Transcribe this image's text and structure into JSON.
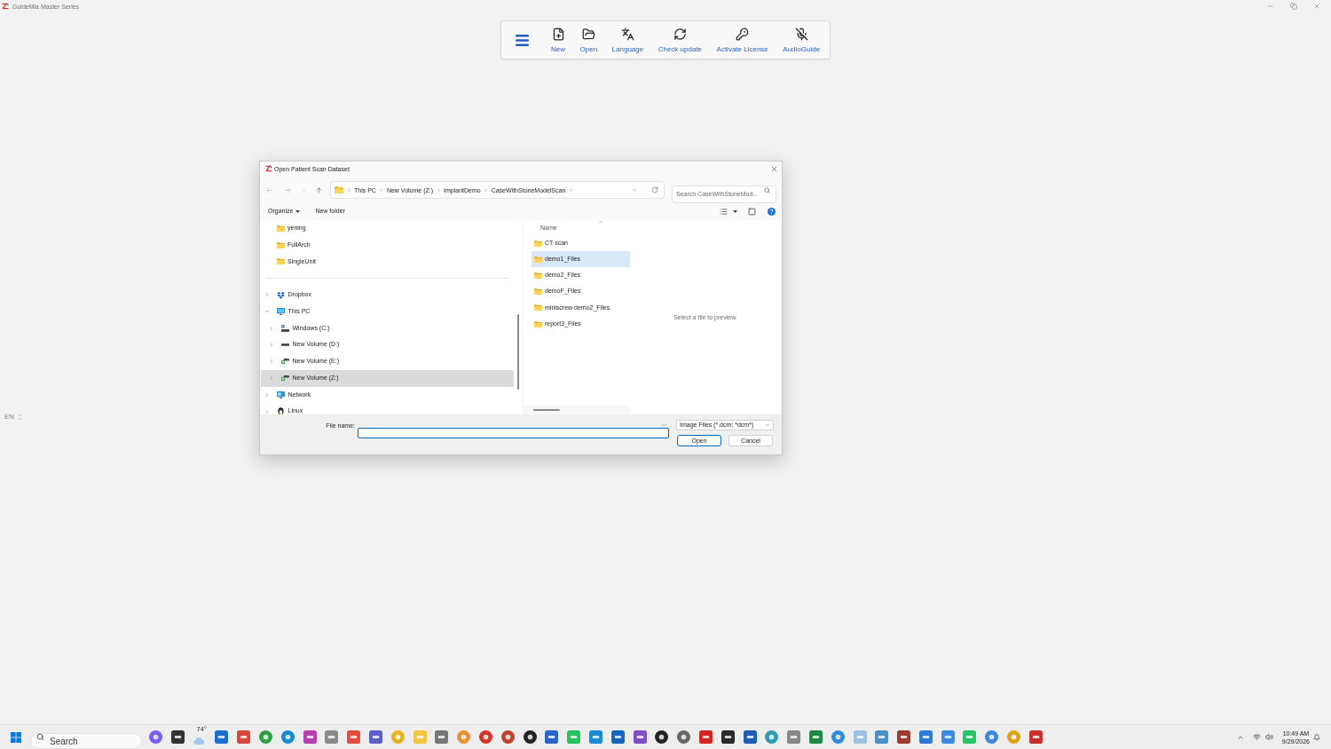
{
  "app": {
    "title": "GuideMia Master Series"
  },
  "toolbar": {
    "items": [
      {
        "label": "New"
      },
      {
        "label": "Open"
      },
      {
        "label": "Language"
      },
      {
        "label": "Check update"
      },
      {
        "label": "Activate License"
      },
      {
        "label": "AudioGuide"
      }
    ]
  },
  "input_indicator": {
    "label": "EN"
  },
  "dialog": {
    "title": "Open Patient Scan Dataset",
    "address": {
      "segments": [
        "This PC",
        "New Volume (Z:)",
        "ImplantDemo",
        "CaseWithStoneModelScan"
      ]
    },
    "search": {
      "placeholder": "Search CaseWithStoneMod..."
    },
    "commands": {
      "organize": "Organize",
      "new_folder": "New folder"
    },
    "nav_pane": {
      "quick_access": [
        {
          "label": "yening",
          "selected": false
        },
        {
          "label": "FullArch",
          "selected": false
        },
        {
          "label": "SingleUnit",
          "selected": false
        }
      ],
      "tree": [
        {
          "label": "Dropbox",
          "kind": "cloud",
          "expanded": false,
          "selected": false
        },
        {
          "label": "This PC",
          "kind": "computer",
          "expanded": true,
          "selected": false,
          "children": [
            {
              "label": "Windows (C:)",
              "kind": "systemdrive",
              "expanded": false,
              "selected": false
            },
            {
              "label": "New Volume (D:)",
              "kind": "drive",
              "expanded": false,
              "selected": false
            },
            {
              "label": "New Volume (E:)",
              "kind": "netdrive",
              "expanded": false,
              "selected": false
            },
            {
              "label": "New Volume (Z:)",
              "kind": "netdrive",
              "expanded": false,
              "selected": true
            }
          ]
        },
        {
          "label": "Network",
          "kind": "network",
          "expanded": false,
          "selected": false
        },
        {
          "label": "Linux",
          "kind": "linux",
          "expanded": false,
          "selected": false
        }
      ]
    },
    "files": {
      "column": "Name",
      "rows": [
        {
          "name": "CT scan",
          "selected": false
        },
        {
          "name": "demo1_Files",
          "selected": true
        },
        {
          "name": "demo2_Files",
          "selected": false
        },
        {
          "name": "demoF_Files",
          "selected": false
        },
        {
          "name": "miniscrew demo2_Files",
          "selected": false
        },
        {
          "name": "report3_Files",
          "selected": false
        }
      ]
    },
    "preview": {
      "message": "Select a file to preview."
    },
    "file_name": {
      "label": "File name:"
    },
    "file_type": {
      "value": "Image Files (*.dcm; *dcm*)"
    },
    "buttons": [
      {
        "label": "Open",
        "default": true
      },
      {
        "label": "Cancel",
        "default": false
      }
    ]
  },
  "taskbar": {
    "search": {
      "placeholder": "Search"
    },
    "weather": {
      "temperature": "74°"
    },
    "clock": {
      "time": "10:49 AM",
      "date": "9/29/2026"
    }
  }
}
